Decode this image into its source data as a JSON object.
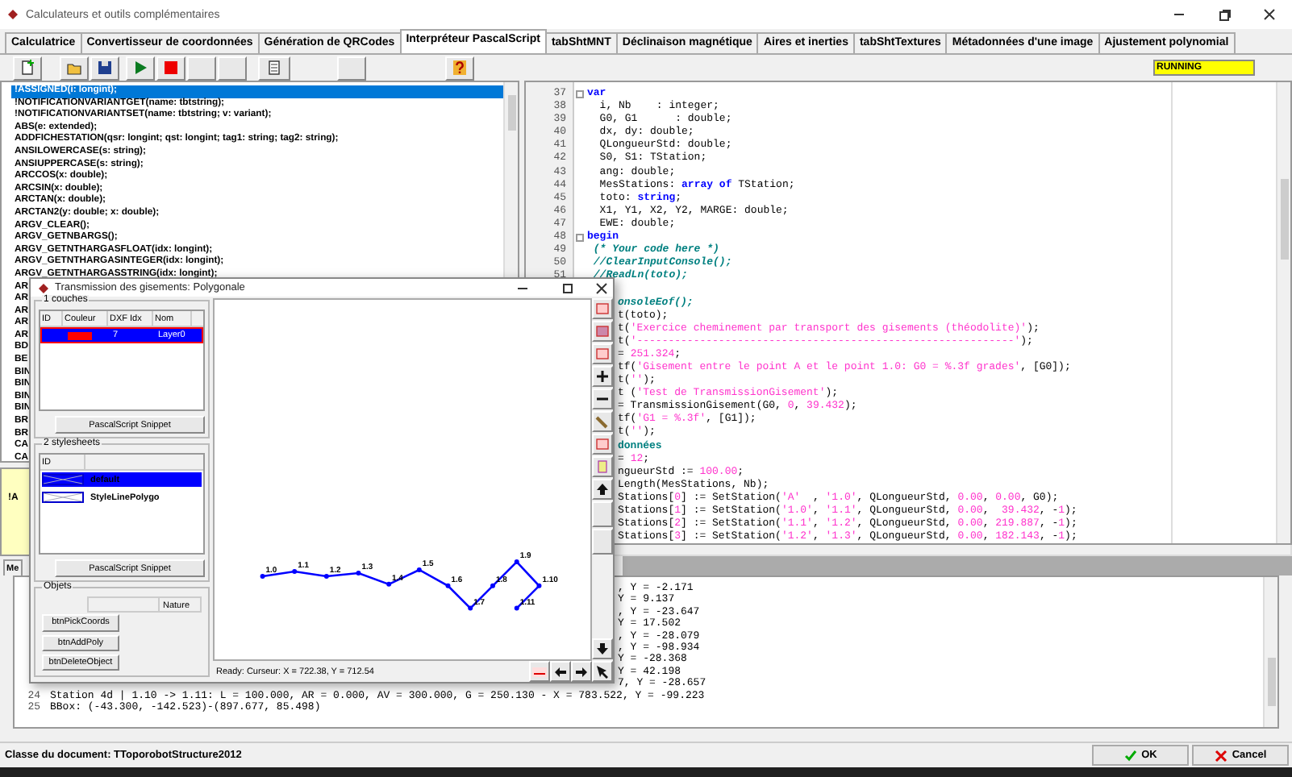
{
  "window": {
    "title": "Calculateurs et outils complémentaires"
  },
  "tabs": [
    {
      "label": "Calculatrice",
      "selected": false
    },
    {
      "label": "Convertisseur de coordonnées",
      "selected": false
    },
    {
      "label": "Génération de QRCodes",
      "selected": false
    },
    {
      "label": "Interpréteur PascalScript",
      "selected": true
    },
    {
      "label": "tabShtMNT",
      "selected": false
    },
    {
      "label": "Déclinaison magnétique",
      "selected": false
    },
    {
      "label": "Aires et inerties",
      "selected": false
    },
    {
      "label": "tabShtTextures",
      "selected": false
    },
    {
      "label": "Métadonnées d'une image",
      "selected": false
    },
    {
      "label": "Ajustement polynomial",
      "selected": false
    }
  ],
  "run_status": "RUNNING",
  "function_list": {
    "items": [
      {
        "text": "!ASSIGNED(i: longint);",
        "selected": true
      },
      {
        "text": "!NOTIFICATIONVARIANTGET(name: tbtstring);",
        "selected": false
      },
      {
        "text": "!NOTIFICATIONVARIANTSET(name: tbtstring; v: variant);",
        "selected": false
      },
      {
        "text": "ABS(e: extended);",
        "selected": false
      },
      {
        "text": "ADDFICHESTATION(qsr: longint; qst: longint; tag1: string; tag2: string);",
        "selected": false
      },
      {
        "text": "ANSILOWERCASE(s: string);",
        "selected": false
      },
      {
        "text": "ANSIUPPERCASE(s: string);",
        "selected": false
      },
      {
        "text": "ARCCOS(x: double);",
        "selected": false
      },
      {
        "text": "ARCSIN(x: double);",
        "selected": false
      },
      {
        "text": "ARCTAN(x: double);",
        "selected": false
      },
      {
        "text": "ARCTAN2(y: double; x: double);",
        "selected": false
      },
      {
        "text": "ARGV_CLEAR();",
        "selected": false
      },
      {
        "text": "ARGV_GETNBARGS();",
        "selected": false
      },
      {
        "text": "ARGV_GETNTHARGASFLOAT(idx: longint);",
        "selected": false
      },
      {
        "text": "ARGV_GETNTHARGASINTEGER(idx: longint);",
        "selected": false
      },
      {
        "text": "ARGV_GETNTHARGASSTRING(idx: longint);",
        "selected": false
      },
      {
        "text": "AR",
        "selected": false
      },
      {
        "text": "AR",
        "selected": false
      },
      {
        "text": "AR",
        "selected": false
      },
      {
        "text": "AR",
        "selected": false
      },
      {
        "text": "AR",
        "selected": false
      },
      {
        "text": "BD",
        "selected": false
      },
      {
        "text": "BE",
        "selected": false
      },
      {
        "text": "BIN",
        "selected": false
      },
      {
        "text": "BIN",
        "selected": false
      },
      {
        "text": "BIN",
        "selected": false
      },
      {
        "text": "BIN",
        "selected": false
      },
      {
        "text": "BR",
        "selected": false
      },
      {
        "text": "BR",
        "selected": false
      },
      {
        "text": "CA",
        "selected": false
      },
      {
        "text": "CA",
        "selected": false
      }
    ]
  },
  "lower_panel": {
    "text": "!A",
    "tab": "Me"
  },
  "editor": {
    "lines": [
      {
        "number": "37",
        "fold": true,
        "segments": [
          {
            "text": "var",
            "kind": "keyword"
          }
        ]
      },
      {
        "number": "38",
        "fold": false,
        "segments": [
          {
            "text": "  i, Nb    : integer;",
            "kind": "plain"
          }
        ]
      },
      {
        "number": "39",
        "fold": false,
        "segments": [
          {
            "text": "  G0, G1      : double;",
            "kind": "plain"
          }
        ]
      },
      {
        "number": "40",
        "fold": false,
        "segments": [
          {
            "text": "  dx, dy: double;",
            "kind": "plain"
          }
        ]
      },
      {
        "number": "41",
        "fold": false,
        "segments": [
          {
            "text": "  QLongueurStd: double;",
            "kind": "plain"
          }
        ]
      },
      {
        "number": "42",
        "fold": false,
        "segments": [
          {
            "text": "  S0, S1: TStation;",
            "kind": "plain"
          }
        ]
      },
      {
        "number": "43",
        "fold": false,
        "segments": [
          {
            "text": "  ang: double;",
            "kind": "plain"
          }
        ]
      },
      {
        "number": "44",
        "fold": false,
        "segments": [
          {
            "text": "  MesStations: ",
            "kind": "plain"
          },
          {
            "text": "array of",
            "kind": "keyword"
          },
          {
            "text": " TStation;",
            "kind": "plain"
          }
        ]
      },
      {
        "number": "45",
        "fold": false,
        "segments": [
          {
            "text": "  toto: ",
            "kind": "plain"
          },
          {
            "text": "string",
            "kind": "keyword"
          },
          {
            "text": ";",
            "kind": "plain"
          }
        ]
      },
      {
        "number": "46",
        "fold": false,
        "segments": [
          {
            "text": "  X1, Y1, X2, Y2, MARGE: double;",
            "kind": "plain"
          }
        ]
      },
      {
        "number": "47",
        "fold": false,
        "segments": [
          {
            "text": "  EWE: double;",
            "kind": "plain"
          }
        ]
      },
      {
        "number": "48",
        "fold": true,
        "segments": [
          {
            "text": "begin",
            "kind": "keyword"
          }
        ]
      },
      {
        "number": "49",
        "fold": false,
        "segments": [
          {
            "text": " (* Your code here *)",
            "kind": "comment"
          }
        ]
      },
      {
        "number": "50",
        "fold": false,
        "segments": [
          {
            "text": " //ClearInputConsole();",
            "kind": "comment"
          }
        ]
      },
      {
        "number": "51",
        "fold": false,
        "segments": [
          {
            "text": " //ReadLn(toto);",
            "kind": "comment"
          }
        ]
      },
      {
        "segments": [
          {
            "text": "onsoleEof();",
            "kind": "comment"
          }
        ]
      },
      {
        "segments": [
          {
            "text": "t(toto);",
            "kind": "plain"
          }
        ]
      },
      {
        "segments": [
          {
            "text": "t(",
            "kind": "plain"
          },
          {
            "text": "'Exercice cheminement par transport des gisements (théodolite)'",
            "kind": "string"
          },
          {
            "text": ");",
            "kind": "plain"
          }
        ]
      },
      {
        "segments": [
          {
            "text": "t(",
            "kind": "plain"
          },
          {
            "text": "'------------------------------------------------------------'",
            "kind": "string"
          },
          {
            "text": ");",
            "kind": "plain"
          }
        ]
      },
      {
        "segments": [
          {
            "text": "= ",
            "kind": "plain"
          },
          {
            "text": "251.324",
            "kind": "number"
          },
          {
            "text": ";",
            "kind": "plain"
          }
        ]
      },
      {
        "segments": [
          {
            "text": "tf(",
            "kind": "plain"
          },
          {
            "text": "'Gisement entre le point A et le point 1.0: G0 = %.3f grades'",
            "kind": "string"
          },
          {
            "text": ", [G0]);",
            "kind": "plain"
          }
        ]
      },
      {
        "segments": [
          {
            "text": "t(",
            "kind": "plain"
          },
          {
            "text": "''",
            "kind": "string"
          },
          {
            "text": ");",
            "kind": "plain"
          }
        ]
      },
      {
        "segments": [
          {
            "text": "t (",
            "kind": "plain"
          },
          {
            "text": "'Test de TransmissionGisement'",
            "kind": "string"
          },
          {
            "text": ");",
            "kind": "plain"
          }
        ]
      },
      {
        "segments": [
          {
            "text": "= TransmissionGisement(G0, ",
            "kind": "plain"
          },
          {
            "text": "0",
            "kind": "number"
          },
          {
            "text": ", ",
            "kind": "plain"
          },
          {
            "text": "39.432",
            "kind": "number"
          },
          {
            "text": ");",
            "kind": "plain"
          }
        ]
      },
      {
        "segments": [
          {
            "text": "tf(",
            "kind": "plain"
          },
          {
            "text": "'G1 = %.3f'",
            "kind": "string"
          },
          {
            "text": ", [G1]);",
            "kind": "plain"
          }
        ]
      },
      {
        "segments": [
          {
            "text": "t(",
            "kind": "plain"
          },
          {
            "text": "''",
            "kind": "string"
          },
          {
            "text": ");",
            "kind": "plain"
          }
        ]
      },
      {
        "segments": [
          {
            "text": "données",
            "kind": "heading"
          }
        ]
      },
      {
        "segments": [
          {
            "text": "= ",
            "kind": "plain"
          },
          {
            "text": "12",
            "kind": "number"
          },
          {
            "text": ";",
            "kind": "plain"
          }
        ]
      },
      {
        "segments": [
          {
            "text": "ngueurStd := ",
            "kind": "plain"
          },
          {
            "text": "100.00",
            "kind": "number"
          },
          {
            "text": ";",
            "kind": "plain"
          }
        ]
      },
      {
        "segments": [
          {
            "text": "Length(MesStations, Nb);",
            "kind": "plain"
          }
        ]
      },
      {
        "segments": [
          {
            "text": "Stations[",
            "kind": "plain"
          },
          {
            "text": "0",
            "kind": "number"
          },
          {
            "text": "] := SetStation(",
            "kind": "plain"
          },
          {
            "text": "'A'  ",
            "kind": "string"
          },
          {
            "text": ", ",
            "kind": "plain"
          },
          {
            "text": "'1.0'",
            "kind": "string"
          },
          {
            "text": ", QLongueurStd, ",
            "kind": "plain"
          },
          {
            "text": "0.00",
            "kind": "number"
          },
          {
            "text": ", ",
            "kind": "plain"
          },
          {
            "text": "0.00",
            "kind": "number"
          },
          {
            "text": ", G0);",
            "kind": "plain"
          }
        ]
      },
      {
        "segments": [
          {
            "text": "Stations[",
            "kind": "plain"
          },
          {
            "text": "1",
            "kind": "number"
          },
          {
            "text": "] := SetStation(",
            "kind": "plain"
          },
          {
            "text": "'1.0'",
            "kind": "string"
          },
          {
            "text": ", ",
            "kind": "plain"
          },
          {
            "text": "'1.1'",
            "kind": "string"
          },
          {
            "text": ", QLongueurStd, ",
            "kind": "plain"
          },
          {
            "text": "0.00",
            "kind": "number"
          },
          {
            "text": ",  ",
            "kind": "plain"
          },
          {
            "text": "39.432",
            "kind": "number"
          },
          {
            "text": ", -",
            "kind": "plain"
          },
          {
            "text": "1",
            "kind": "number"
          },
          {
            "text": ");",
            "kind": "plain"
          }
        ]
      },
      {
        "segments": [
          {
            "text": "Stations[",
            "kind": "plain"
          },
          {
            "text": "2",
            "kind": "number"
          },
          {
            "text": "] := SetStation(",
            "kind": "plain"
          },
          {
            "text": "'1.1'",
            "kind": "string"
          },
          {
            "text": ", ",
            "kind": "plain"
          },
          {
            "text": "'1.2'",
            "kind": "string"
          },
          {
            "text": ", QLongueurStd, ",
            "kind": "plain"
          },
          {
            "text": "0.00",
            "kind": "number"
          },
          {
            "text": ", ",
            "kind": "plain"
          },
          {
            "text": "219.887",
            "kind": "number"
          },
          {
            "text": ", -",
            "kind": "plain"
          },
          {
            "text": "1",
            "kind": "number"
          },
          {
            "text": ");",
            "kind": "plain"
          }
        ]
      },
      {
        "segments": [
          {
            "text": "Stations[",
            "kind": "plain"
          },
          {
            "text": "3",
            "kind": "number"
          },
          {
            "text": "] := SetStation(",
            "kind": "plain"
          },
          {
            "text": "'1.2'",
            "kind": "string"
          },
          {
            "text": ", ",
            "kind": "plain"
          },
          {
            "text": "'1.3'",
            "kind": "string"
          },
          {
            "text": ", QLongueurStd, ",
            "kind": "plain"
          },
          {
            "text": "0.00",
            "kind": "number"
          },
          {
            "text": ", ",
            "kind": "plain"
          },
          {
            "text": "182.143",
            "kind": "number"
          },
          {
            "text": ", -",
            "kind": "plain"
          },
          {
            "text": "1",
            "kind": "number"
          },
          {
            "text": ");",
            "kind": "plain"
          }
        ]
      }
    ]
  },
  "output": {
    "lines": [
      {
        "text": ", Y = -2.171"
      },
      {
        "text": "Y = 9.137"
      },
      {
        "text": ", Y = -23.647"
      },
      {
        "text": "Y = 17.502"
      },
      {
        "text": ", Y = -28.079"
      },
      {
        "text": ", Y = -98.934"
      },
      {
        "text": "Y = -28.368"
      },
      {
        "text": "Y = 42.198"
      },
      {
        "text": "7, Y = -28.657"
      },
      {
        "number": "24",
        "text": "Station 4d | 1.10 -> 1.11: L = 100.000, AR = 0.000, AV = 300.000, G = 250.130 - X = 783.522, Y = -99.223"
      },
      {
        "number": "25",
        "text": "BBox: (-43.300, -142.523)-(897.677, 85.498)"
      }
    ]
  },
  "dialog": {
    "title": "Transmission des gisements: Polygonale",
    "layers": {
      "legend": "1 couches",
      "columns": [
        "ID",
        "Couleur",
        "DXF Idx",
        "Nom"
      ],
      "rows": [
        {
          "color": "#ff0000",
          "dxf_idx": "7",
          "name": "Layer0",
          "selected": true
        }
      ],
      "button": "PascalScript Snippet"
    },
    "stylesheets": {
      "legend": "2 stylesheets",
      "columns": [
        "ID"
      ],
      "rows": [
        {
          "name": "default",
          "selected": true
        },
        {
          "name": "StyleLinePolygo",
          "selected": false
        }
      ],
      "button": "PascalScript Snippet"
    },
    "objects": {
      "legend": "Objets",
      "columns": [
        "Nature"
      ],
      "buttons": [
        "btnPickCoords",
        "btnAddPoly",
        "btnDeleteObject"
      ]
    },
    "point_labels": [
      "1.0",
      "1.1",
      "1.2",
      "1.3",
      "1.4",
      "1.5",
      "1.6",
      "1.7",
      "1.8",
      "1.9",
      "1.10",
      "1.11"
    ],
    "status": "Ready: Curseur: X = 722.38, Y = 712.54"
  },
  "status_bar": {
    "text": "Classe du document: TToporobotStructure2012",
    "buttons": [
      {
        "label": "OK",
        "kind": "ok"
      },
      {
        "label": "Cancel",
        "kind": "cancel"
      }
    ]
  }
}
